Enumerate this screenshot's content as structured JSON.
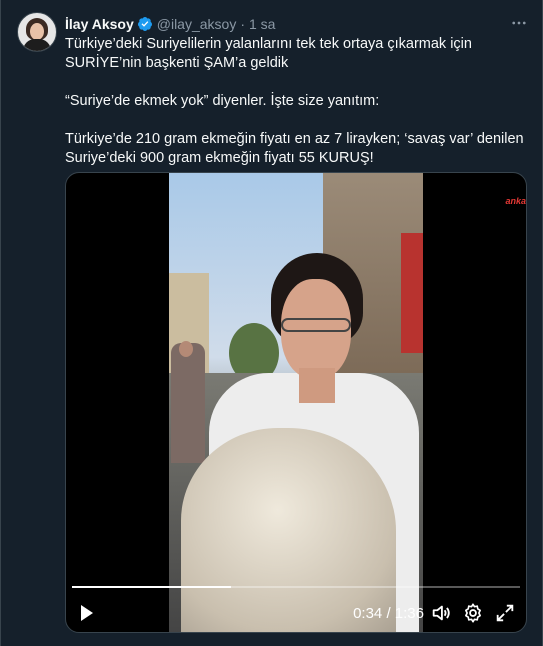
{
  "author": {
    "name": "İlay Aksoy",
    "handle": "@ilay_aksoy",
    "separator": "·",
    "time": "1 sa"
  },
  "tweet": {
    "lines": [
      "Türkiye’deki Suriyelilerin yalanlarını tek tek ortaya çıkarmak için SURİYE’nin başkenti ŞAM’a geldik",
      "“Suriye’de ekmek yok” diyenler. İşte size yanıtım:",
      "Türkiye’de 210 gram ekmeğin fiyatı en az 7 lirayken; ‘savaş var’ denilen Suriye’deki 900 gram ekmeğin fiyatı 55 KURUŞ!"
    ]
  },
  "video": {
    "watermark": "anka",
    "current_time": "0:34",
    "time_separator": " / ",
    "duration": "1:36",
    "progress": 0.354
  },
  "icons": {
    "verified": "verified-badge-icon",
    "more": "more-icon",
    "play": "play-icon",
    "volume": "volume-icon",
    "settings": "settings-icon",
    "fullscreen": "fullscreen-icon"
  },
  "colors": {
    "background": "#15202b",
    "secondary_text": "#8b98a5",
    "verified_blue": "#1d9bf0"
  }
}
